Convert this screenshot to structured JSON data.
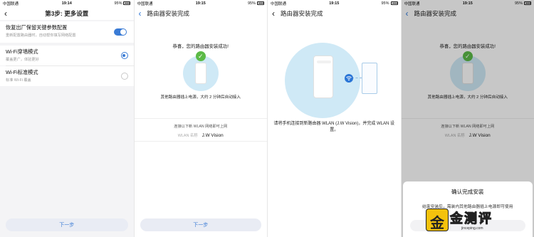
{
  "panels": [
    {
      "status": {
        "carrier": "中国联通",
        "time": "19:14",
        "battery": "95%"
      },
      "title": "第3步: 更多设置",
      "settings": [
        {
          "title": "恢复出厂保留关键参数配置",
          "subtitle": "重新配置路由器时，自动帮你填写网络配置",
          "control": "toggle",
          "state": "on"
        },
        {
          "title": "Wi-Fi穿墙模式",
          "subtitle": "覆盖更广，体验更好",
          "control": "radio",
          "state": "selected"
        },
        {
          "title": "Wi-Fi标准模式",
          "subtitle": "标准 Wi-Fi 覆盖",
          "control": "radio",
          "state": "unselected"
        }
      ],
      "button": "下一步"
    },
    {
      "status": {
        "carrier": "中国联通",
        "time": "19:15",
        "battery": "95%"
      },
      "title": "路由器安装完成",
      "congrats": "恭喜，您的路由器安装成功!",
      "hint": "其他路由器插上电源，大约 2 分钟后自动接入",
      "connect_tip": "连接以下新 WLAN 网络即可上网",
      "wlan_label": "WLAN 名称",
      "wlan_value": "J.W Vision",
      "button": "下一步"
    },
    {
      "status": {
        "carrier": "中国联通",
        "time": "19:15",
        "battery": "95%"
      },
      "title": "路由器安装完成",
      "instruction": "请将手机连接到新路由器 WLAN (J.W Vision)，并完成 WLAN 设置。"
    },
    {
      "status": {
        "carrier": "中国联通",
        "time": "19:15",
        "battery": "95%"
      },
      "title": "路由器安装完成",
      "congrats": "恭喜，您的路由器安装成功!",
      "hint": "其他路由器插上电源，大约 2 分钟后自动接入",
      "connect_tip": "连接以下新 WLAN 网络即可上网",
      "wlan_label": "WLAN 名称",
      "wlan_value": "J.W Vision",
      "dialog_title": "确认完成安装",
      "dialog_text": "结束安装后，需装内其他路由器插上电源即可使用"
    }
  ],
  "watermark": {
    "logo_char": "金",
    "word": "金测评",
    "url": "jinceping.com"
  },
  "colors": {
    "accent": "#3a7bd5",
    "success": "#5cba47",
    "device_bg": "#cfe9f6",
    "seal": "#f4c20d"
  }
}
